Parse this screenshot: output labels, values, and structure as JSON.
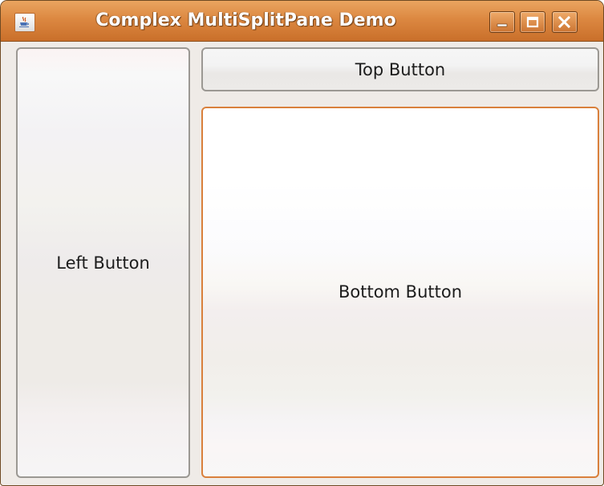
{
  "window": {
    "title": "Complex MultiSplitPane Demo",
    "icon": "java-cup-icon",
    "controls": {
      "minimize": "minimize-icon",
      "maximize": "maximize-icon",
      "close": "close-icon"
    },
    "accent_color": "#dc8841"
  },
  "buttons": {
    "left": "Left Button",
    "top": "Top Button",
    "bottom": "Bottom Button"
  },
  "focused_button": "bottom"
}
